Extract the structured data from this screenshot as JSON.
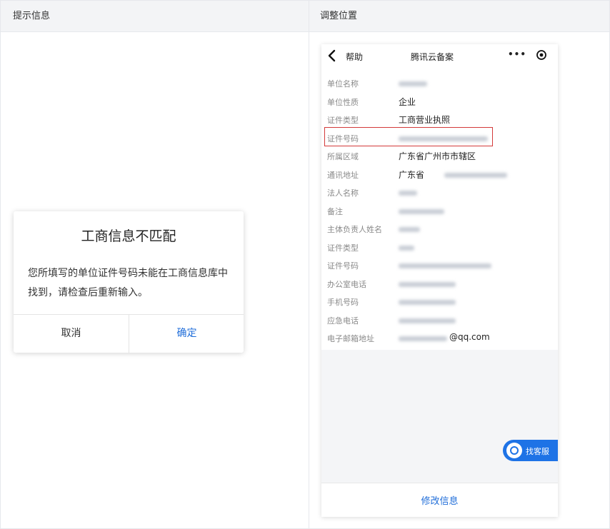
{
  "table": {
    "headers": [
      "提示信息",
      "调整位置"
    ]
  },
  "dialog": {
    "title": "工商信息不匹配",
    "message": "您所填写的单位证件号码未能在工商信息库中找到，请检查后重新输入。",
    "cancel_label": "取消",
    "confirm_label": "确定"
  },
  "phone": {
    "back_label": "帮助",
    "title": "腾讯云备案",
    "more_icon": "more-icon",
    "target_icon": "target-icon",
    "fields": [
      {
        "label": "单位名称",
        "value": "",
        "blurred": true
      },
      {
        "label": "单位性质",
        "value": "企业",
        "blurred": false
      },
      {
        "label": "证件类型",
        "value": "工商营业执照",
        "blurred": false
      },
      {
        "label": "证件号码",
        "value": "",
        "blurred": true,
        "highlighted": true
      },
      {
        "label": "所属区域",
        "value": "广东省广州市市辖区",
        "blurred": false
      },
      {
        "label": "通讯地址",
        "value": "广东省",
        "blurred": true
      },
      {
        "label": "法人名称",
        "value": "",
        "blurred": true
      },
      {
        "label": "备注",
        "value": "",
        "blurred": true
      },
      {
        "label": "主体负责人姓名",
        "value": "",
        "blurred": true
      },
      {
        "label": "证件类型",
        "value": "",
        "blurred": true
      },
      {
        "label": "证件号码",
        "value": "",
        "blurred": true
      },
      {
        "label": "办公室电话",
        "value": "",
        "blurred": true
      },
      {
        "label": "手机号码",
        "value": "",
        "blurred": true
      },
      {
        "label": "应急电话",
        "value": "",
        "blurred": true
      },
      {
        "label": "电子邮箱地址",
        "value": "@qq.com",
        "blurred": true
      }
    ],
    "customer_service_label": "找客服",
    "footer_label": "修改信息",
    "colors": {
      "accent": "#1f6dd9",
      "highlight": "#d33a3a"
    }
  }
}
